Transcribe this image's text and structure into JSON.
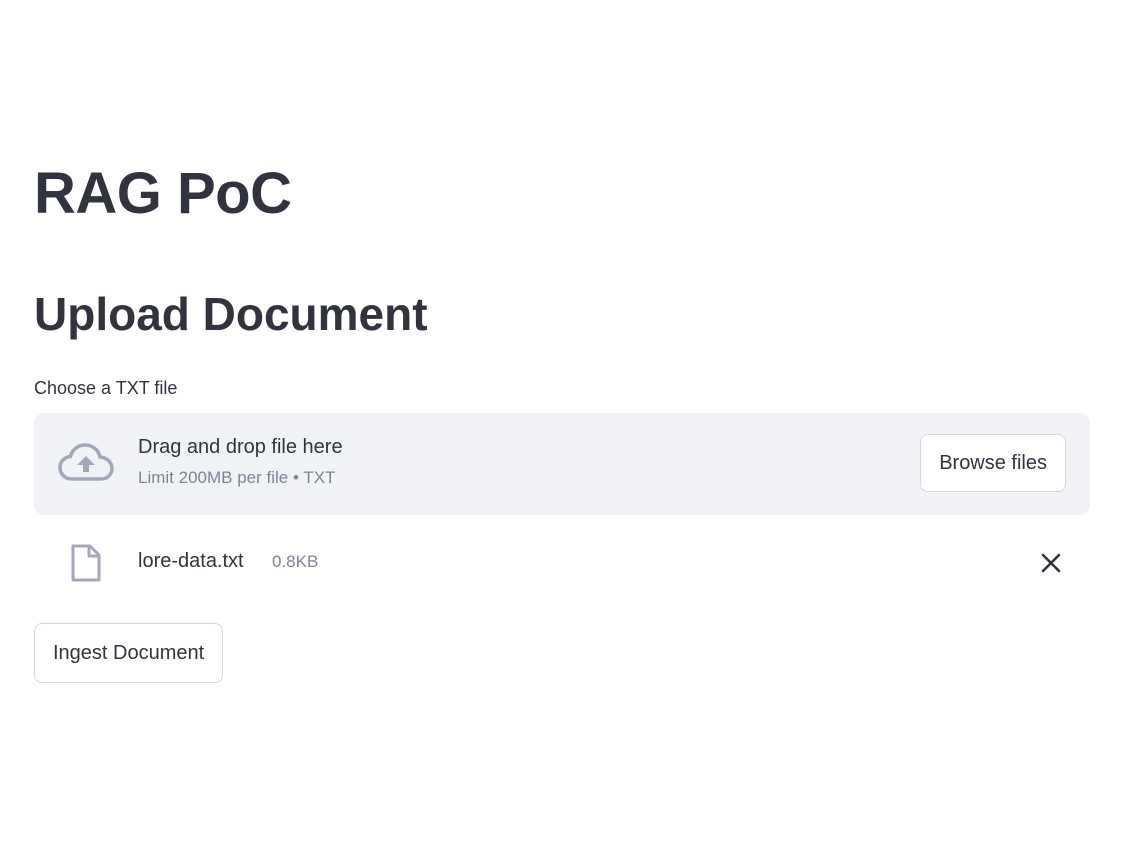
{
  "page": {
    "title": "RAG PoC",
    "section_title": "Upload Document"
  },
  "uploader": {
    "label": "Choose a TXT file",
    "dropzone_title": "Drag and drop file here",
    "dropzone_limit": "Limit 200MB per file • TXT",
    "browse_label": "Browse files",
    "icon": "cloud-upload-icon"
  },
  "uploaded_file": {
    "name": "lore-data.txt",
    "size": "0.8KB",
    "icon": "file-icon",
    "remove_icon": "close-icon"
  },
  "actions": {
    "ingest_label": "Ingest Document"
  },
  "colors": {
    "text": "#31333f",
    "muted": "#808495",
    "dropzone_bg": "#f0f2f6",
    "icon": "#a3a8b8",
    "border": "#d5d7df"
  }
}
